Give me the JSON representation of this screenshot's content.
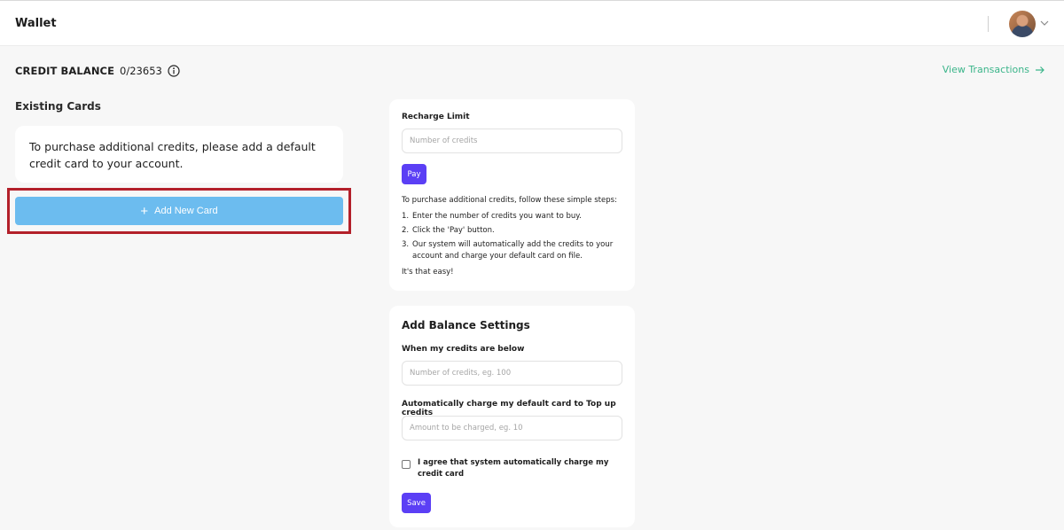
{
  "header": {
    "title": "Wallet"
  },
  "credit": {
    "label": "CREDIT BALANCE",
    "value": "0/23653",
    "view_transactions": "View Transactions"
  },
  "existing_cards": {
    "title": "Existing Cards",
    "notice": "To purchase additional credits, please add a default credit card to your account.",
    "add_button": "Add New Card"
  },
  "recharge": {
    "label": "Recharge Limit",
    "placeholder": "Number of credits",
    "pay_button": "Pay",
    "intro": "To purchase additional credits, follow these simple steps:",
    "steps": [
      {
        "num": "1.",
        "text": "Enter the number of credits you want to buy."
      },
      {
        "num": "2.",
        "text": "Click the 'Pay' button."
      },
      {
        "num": "3.",
        "text": "Our system will automatically add the credits to your account and charge your default card on file."
      }
    ],
    "outro": "It's that easy!"
  },
  "balance_settings": {
    "title": "Add Balance Settings",
    "below_label": "When my credits are below",
    "below_placeholder": "Number of credits, eg. 100",
    "charge_label": "Automatically charge my default card to Top up credits",
    "charge_placeholder": "Amount to be charged, eg. 10",
    "agree_text": "I agree that system automatically charge my credit card",
    "save_button": "Save"
  },
  "colors": {
    "accent_purple": "#5b3ff5",
    "add_card_blue": "#6cbcef",
    "link_green": "#3bb58a",
    "highlight_red": "#b3202a"
  },
  "icons": [
    "info-icon",
    "arrow-right-icon",
    "plus-icon",
    "chevron-down-icon",
    "avatar"
  ]
}
